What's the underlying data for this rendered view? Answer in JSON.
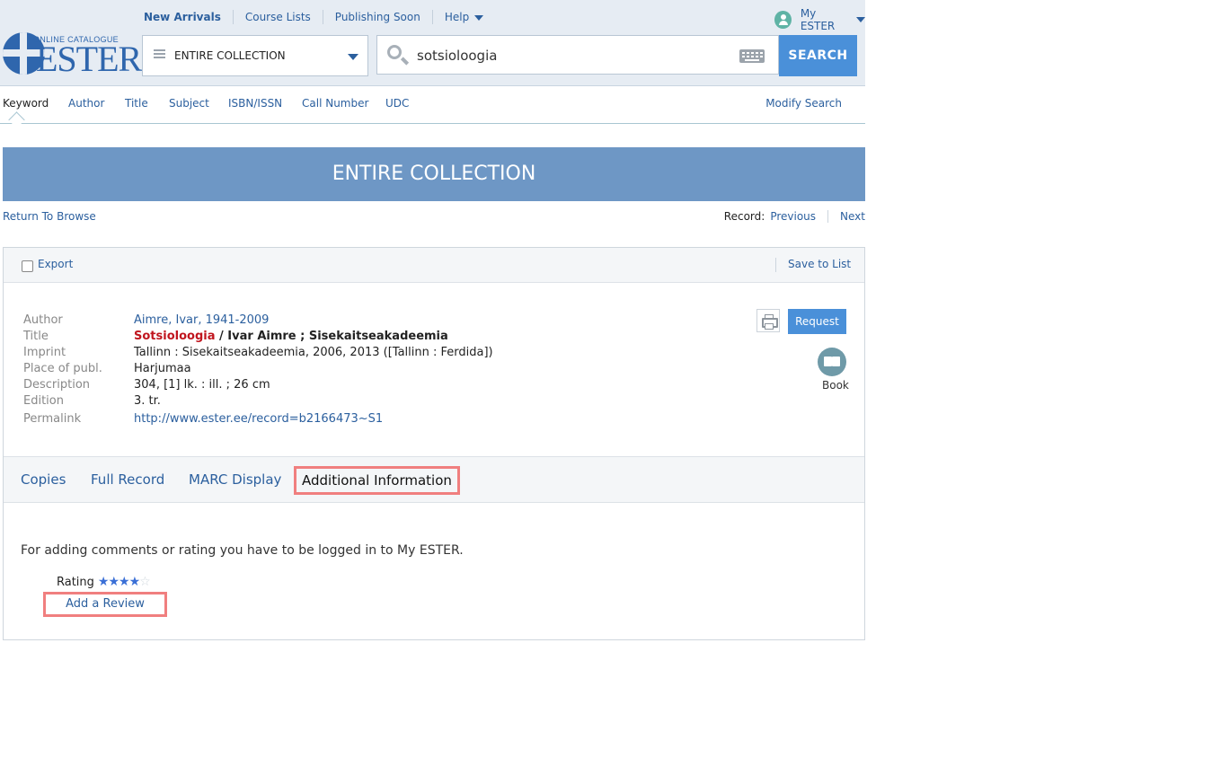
{
  "topnav": {
    "new_arrivals": "New Arrivals",
    "course_lists": "Course Lists",
    "publishing_soon": "Publishing Soon",
    "help": "Help",
    "my_ester": "My ESTER"
  },
  "logo": {
    "small": "ONLINE CATALOGUE",
    "big": "ESTER"
  },
  "search": {
    "scope": "ENTIRE COLLECTION",
    "query": "sotsioloogia",
    "button": "SEARCH"
  },
  "search_types": {
    "items": [
      "Keyword",
      "Author",
      "Title",
      "Subject",
      "ISBN/ISSN",
      "Call Number",
      "UDC"
    ],
    "modify": "Modify Search"
  },
  "banner": {
    "title": "ENTIRE COLLECTION"
  },
  "navigation": {
    "return": "Return To Browse",
    "record_label": "Record:",
    "previous": "Previous",
    "next": "Next"
  },
  "toolbar": {
    "export": "Export",
    "save": "Save to List"
  },
  "record": {
    "author_label": "Author",
    "author": "Aimre, Ivar, 1941-2009",
    "title_label": "Title",
    "title_main": "Sotsioloogia",
    "title_rest": " / Ivar Aimre ; Sisekaitseakadeemia",
    "imprint_label": "Imprint",
    "imprint": "Tallinn : Sisekaitseakadeemia, 2006, 2013 ([Tallinn : Ferdida])",
    "place_label": "Place of publ.",
    "place": "Harjumaa",
    "description_label": "Description",
    "description": "304, [1] lk. : ill. ; 26 cm",
    "edition_label": "Edition",
    "edition": "3. tr.",
    "permalink_label": "Permalink",
    "permalink": "http://www.ester.ee/record=b2166473~S1"
  },
  "actions": {
    "request": "Request",
    "format": "Book"
  },
  "record_tabs": {
    "copies": "Copies",
    "full_record": "Full Record",
    "marc": "MARC Display",
    "additional": "Additional Information"
  },
  "additional_info": {
    "message": "For adding comments or rating you have to be logged in to My ESTER.",
    "rating_label": "Rating",
    "rating_value": 4,
    "rating_max": 5,
    "add_review": "Add a Review"
  },
  "colors": {
    "accent": "#4a90d9",
    "banner": "#6e97c5",
    "link": "#2b5f9e",
    "title_red": "#c0151e",
    "highlight": "#f07f7f"
  }
}
